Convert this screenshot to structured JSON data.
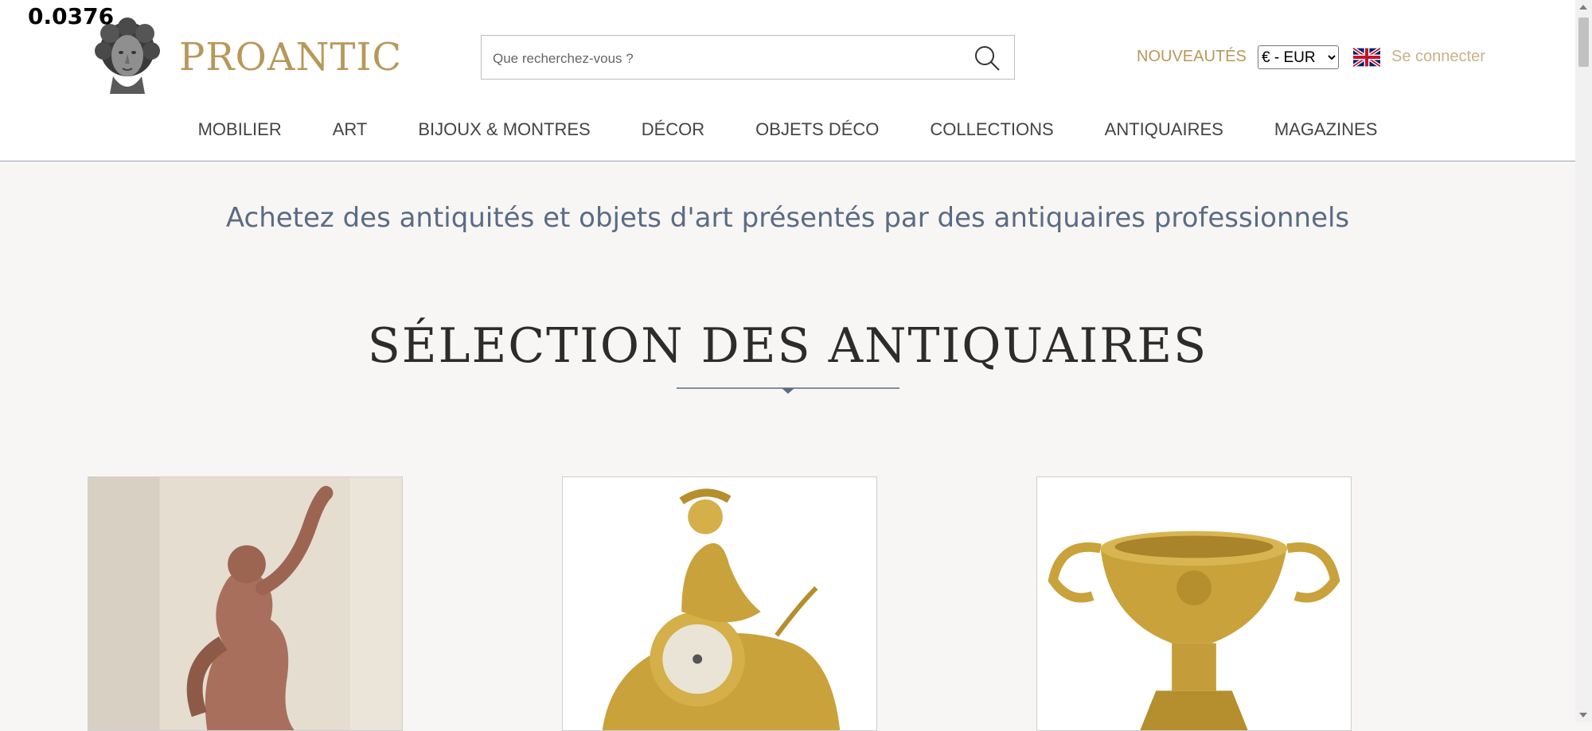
{
  "overlay": {
    "value": "0.0376"
  },
  "header": {
    "brand": "PROANTIC",
    "search_placeholder": "Que recherchez-vous ?",
    "nouveautes": "NOUVEAUTÉS",
    "currency": {
      "selected": "€ - EUR",
      "options": [
        "€ - EUR"
      ]
    },
    "language_flag": "uk-flag-icon",
    "login": "Se connecter"
  },
  "nav": {
    "items": [
      "MOBILIER",
      "ART",
      "BIJOUX & MONTRES",
      "DÉCOR",
      "OBJETS DÉCO",
      "COLLECTIONS",
      "ANTIQUAIRES",
      "MAGAZINES"
    ]
  },
  "main": {
    "tagline": "Achetez des antiquités et objets d'art présentés par des antiquaires professionnels",
    "section_title": "SÉLECTION DES ANTIQUAIRES",
    "cards": [
      {
        "image": "terracotta-sculpture-image"
      },
      {
        "image": "gilt-bronze-clock-image"
      },
      {
        "image": "gilt-bronze-vase-image"
      }
    ]
  },
  "colors": {
    "brand_gold": "#b8985a",
    "tagline_blue": "#5a6b84",
    "background": "#f7f6f4"
  }
}
